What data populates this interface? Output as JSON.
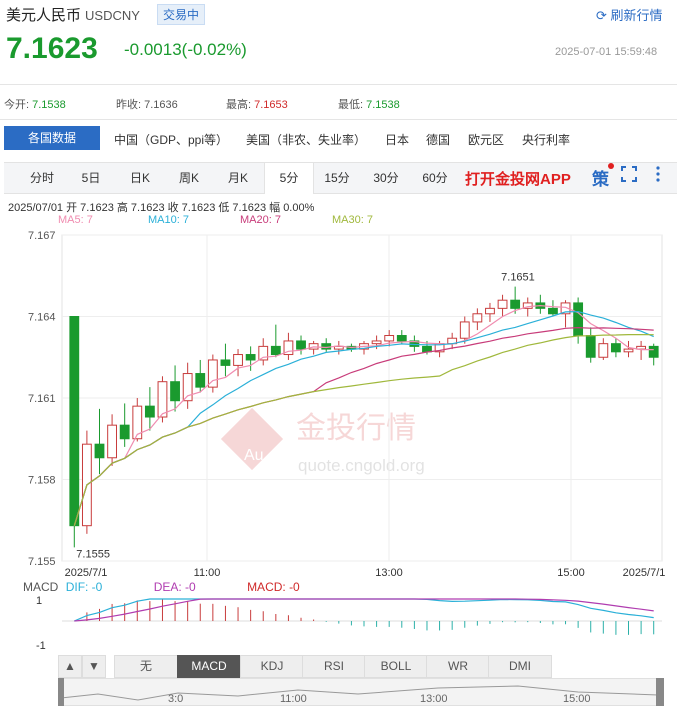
{
  "header": {
    "name": "美元人民币",
    "code": "USDCNY",
    "badge": "交易中",
    "refresh": "刷新行情",
    "price": "7.1623",
    "change": "-0.0013(-0.02%)",
    "timestamp": "2025-07-01 15:59:48"
  },
  "stats": [
    {
      "label": "今开:",
      "value": "7.1538"
    },
    {
      "label": "昨收:",
      "value": "7.1636"
    },
    {
      "label": "最高:",
      "value": "7.1653"
    },
    {
      "label": "最低:",
      "value": "7.1538"
    }
  ],
  "nav": {
    "active": "各国数据",
    "links": [
      "中国（GDP、ppi等）",
      "美国（非农、失业率）",
      "日本",
      "德国",
      "欧元区",
      "央行利率"
    ]
  },
  "period_tabs": [
    "分时",
    "5日",
    "日K",
    "周K",
    "月K",
    "5分",
    "15分",
    "30分",
    "60分"
  ],
  "active_period": "5分",
  "app_cta": "打开金投网APP",
  "toolbar_icons": [
    "strategy-icon",
    "fullscreen-icon",
    "more-icon"
  ],
  "strategy_label": "策",
  "ohlc": "2025/07/01  开 7.1623  高 7.1623  收 7.1623  低 7.1623  幅 0.00%",
  "ma_legend": [
    {
      "label": "MA5: 7",
      "color": "#f08cb0"
    },
    {
      "label": "MA10: 7",
      "color": "#2bb0d8"
    },
    {
      "label": "MA20: 7",
      "color": "#c83c7a"
    },
    {
      "label": "MA30: 7",
      "color": "#a0b83c"
    }
  ],
  "watermark": {
    "brand": "金投行情",
    "url": "quote.cngold.org",
    "logo": "Au"
  },
  "chart_data": {
    "type": "candlestick",
    "yticks": [
      "7.167",
      "7.164",
      "7.161",
      "7.158",
      "7.155"
    ],
    "ylim": [
      7.155,
      7.167
    ],
    "xticks": [
      "2025/7/1",
      "11:00",
      "13:00",
      "15:00",
      "2025/7/1"
    ],
    "annotations": [
      {
        "label": "7.1651",
        "kind": "high"
      },
      {
        "label": "7.1555",
        "kind": "low"
      }
    ],
    "candles": [
      [
        7.164,
        7.164,
        7.1555,
        7.1563
      ],
      [
        7.1563,
        7.1598,
        7.156,
        7.1593
      ],
      [
        7.1593,
        7.1606,
        7.1582,
        7.1588
      ],
      [
        7.1588,
        7.1604,
        7.1585,
        7.16
      ],
      [
        7.16,
        7.1608,
        7.1592,
        7.1595
      ],
      [
        7.1595,
        7.161,
        7.1594,
        7.1607
      ],
      [
        7.1607,
        7.1614,
        7.1598,
        7.1603
      ],
      [
        7.1603,
        7.1618,
        7.1601,
        7.1616
      ],
      [
        7.1616,
        7.1622,
        7.1605,
        7.1609
      ],
      [
        7.1609,
        7.1623,
        7.1606,
        7.1619
      ],
      [
        7.1619,
        7.1624,
        7.1612,
        7.1614
      ],
      [
        7.1614,
        7.1626,
        7.1612,
        7.1624
      ],
      [
        7.1624,
        7.163,
        7.1618,
        7.1622
      ],
      [
        7.1622,
        7.1628,
        7.1618,
        7.1626
      ],
      [
        7.1626,
        7.1629,
        7.162,
        7.1624
      ],
      [
        7.1624,
        7.1632,
        7.1622,
        7.1629
      ],
      [
        7.1629,
        7.1637,
        7.1625,
        7.1626
      ],
      [
        7.1626,
        7.1634,
        7.1624,
        7.1631
      ],
      [
        7.1631,
        7.1633,
        7.1626,
        7.1628
      ],
      [
        7.1628,
        7.1631,
        7.1626,
        7.163
      ],
      [
        7.163,
        7.1632,
        7.1627,
        7.1628
      ],
      [
        7.1628,
        7.1631,
        7.1626,
        7.1629
      ],
      [
        7.1629,
        7.163,
        7.1627,
        7.1628
      ],
      [
        7.1628,
        7.1631,
        7.1626,
        7.163
      ],
      [
        7.163,
        7.1633,
        7.1628,
        7.1631
      ],
      [
        7.1631,
        7.1635,
        7.1629,
        7.1633
      ],
      [
        7.1633,
        7.1635,
        7.163,
        7.1631
      ],
      [
        7.1631,
        7.1633,
        7.1627,
        7.1629
      ],
      [
        7.1629,
        7.1631,
        7.1626,
        7.1627
      ],
      [
        7.1627,
        7.1631,
        7.1625,
        7.163
      ],
      [
        7.163,
        7.1634,
        7.1628,
        7.1632
      ],
      [
        7.1632,
        7.164,
        7.163,
        7.1638
      ],
      [
        7.1638,
        7.1643,
        7.1635,
        7.1641
      ],
      [
        7.1641,
        7.1645,
        7.1638,
        7.1643
      ],
      [
        7.1643,
        7.1648,
        7.164,
        7.1646
      ],
      [
        7.1646,
        7.1651,
        7.1641,
        7.1643
      ],
      [
        7.1643,
        7.1647,
        7.164,
        7.1645
      ],
      [
        7.1645,
        7.1648,
        7.1641,
        7.1643
      ],
      [
        7.1643,
        7.1646,
        7.164,
        7.1641
      ],
      [
        7.1641,
        7.1646,
        7.1636,
        7.1645
      ],
      [
        7.1645,
        7.1647,
        7.163,
        7.1633
      ],
      [
        7.1633,
        7.1636,
        7.1623,
        7.1625
      ],
      [
        7.1625,
        7.1632,
        7.1624,
        7.163
      ],
      [
        7.163,
        7.1632,
        7.1625,
        7.1627
      ],
      [
        7.1627,
        7.1631,
        7.1625,
        7.1628
      ],
      [
        7.1628,
        7.1631,
        7.1624,
        7.1629
      ],
      [
        7.1629,
        7.163,
        7.1622,
        7.1625
      ]
    ],
    "macd_labels": [
      "MACD",
      "DIF: -0",
      "DEA: -0",
      "MACD: -0"
    ],
    "macd_axis": [
      "1",
      "-1"
    ]
  },
  "indicator_tabs": [
    "无",
    "MACD",
    "KDJ",
    "RSI",
    "BOLL",
    "WR",
    "DMI"
  ],
  "active_indicator": "MACD",
  "navigator": {
    "labels": [
      "3:0",
      "11:00",
      "13:00",
      "15:00"
    ]
  }
}
